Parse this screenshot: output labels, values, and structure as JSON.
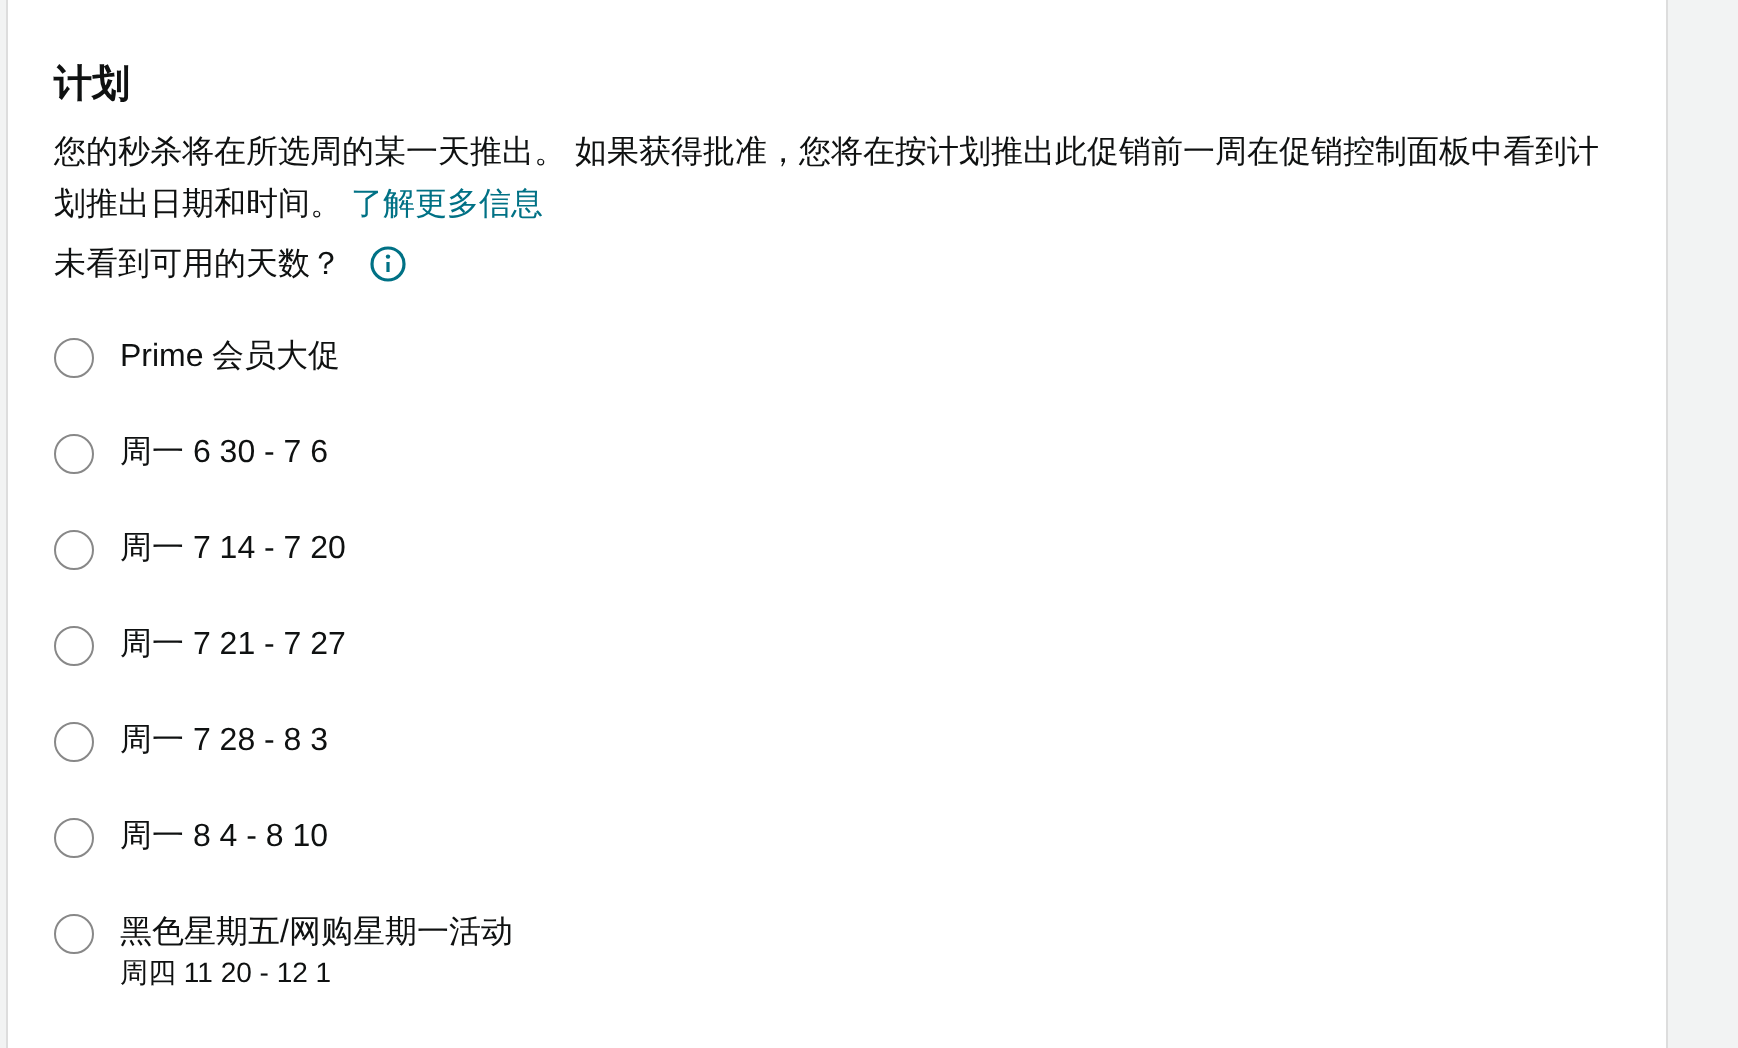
{
  "section": {
    "title": "计划",
    "description": "您的秒杀将在所选周的某一天推出。 如果获得批准，您将在按计划推出此促销前一周在促销控制面板中看到计划推出日期和时间。",
    "link": "了解更多信息",
    "hint": "未看到可用的天数？"
  },
  "options": [
    {
      "label": "Prime 会员大促",
      "selected": false
    },
    {
      "label": "周一 6 30 - 7 6",
      "selected": false
    },
    {
      "label": "周一 7 14 - 7 20",
      "selected": false
    },
    {
      "label": "周一 7 21 - 7 27",
      "selected": false
    },
    {
      "label": "周一 7 28 - 8 3",
      "selected": false
    },
    {
      "label": "周一 8 4 - 8 10",
      "selected": false
    },
    {
      "label": "黑色星期五/网购星期一活动",
      "sublabel": "周四 11 20 - 12 1",
      "selected": false
    }
  ]
}
